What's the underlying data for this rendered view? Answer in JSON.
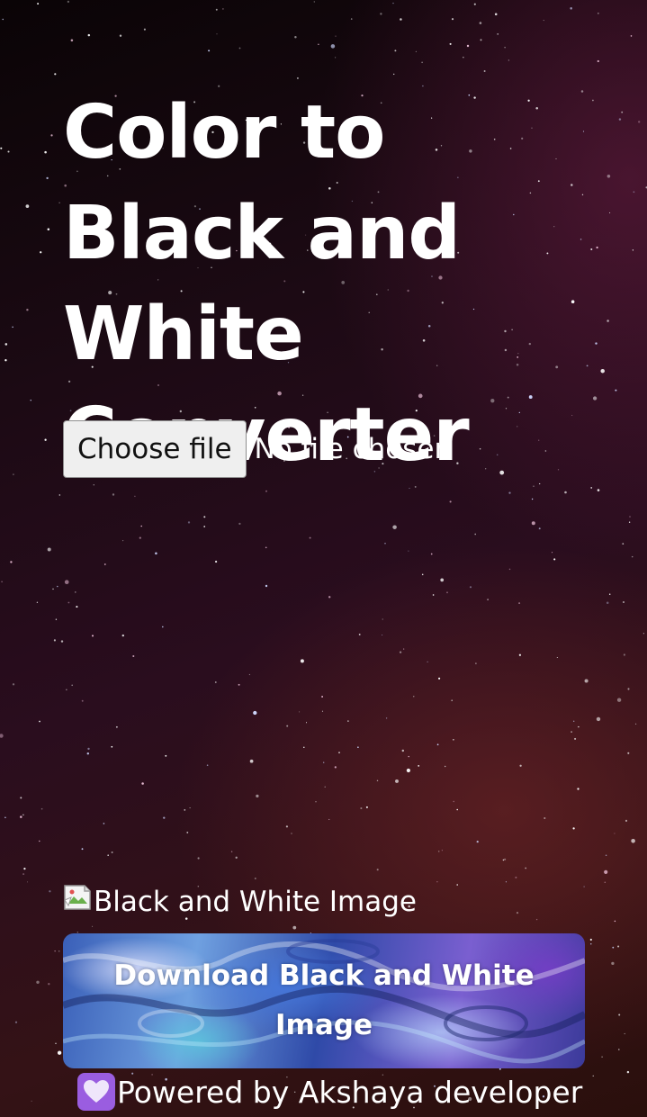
{
  "header": {
    "title": "Color to Black and White Converter"
  },
  "file_input": {
    "button_label": "Choose file",
    "status": "No file chosen"
  },
  "result_image": {
    "alt_text": "Black and White Image"
  },
  "download": {
    "label": "Download Black and White Image"
  },
  "footer": {
    "text": "Powered by Akshaya developer",
    "heart_icon": "purple-heart-icon"
  },
  "colors": {
    "heart_box": "#9a5de0",
    "background_dark": "#1c0a14",
    "background_red": "#341216"
  }
}
